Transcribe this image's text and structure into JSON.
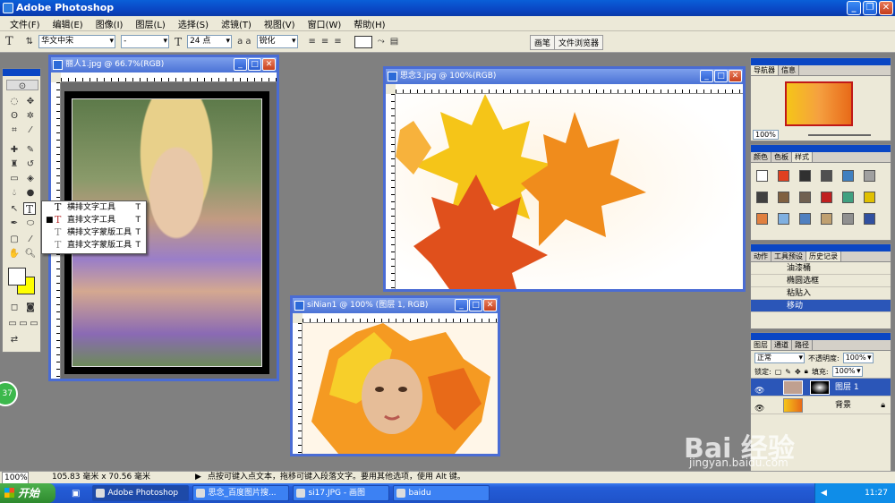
{
  "app": {
    "title": "Adobe Photoshop"
  },
  "menu": [
    "文件(F)",
    "编辑(E)",
    "图像(I)",
    "图层(L)",
    "选择(S)",
    "滤镜(T)",
    "视图(V)",
    "窗口(W)",
    "帮助(H)"
  ],
  "options": {
    "tool_glyph": "T",
    "font_family": "华文中宋",
    "font_style": "-",
    "font_size": "24 点",
    "aa_label": "a a",
    "antialias": "锐化",
    "tab_brushes": "画笔",
    "tab_browser": "文件浏览器"
  },
  "docs": {
    "doc1_title": "丽人1.jpg @ 66.7%(RGB)",
    "doc2_title": "思念3.jpg @ 100%(RGB)",
    "doc3_title": "siNian1 @ 100% (图层 1, RGB)"
  },
  "flyout": {
    "items": [
      {
        "label": "横排文字工具",
        "key": "T"
      },
      {
        "label": "直排文字工具",
        "key": "T"
      },
      {
        "label": "横排文字蒙版工具",
        "key": "T"
      },
      {
        "label": "直排文字蒙版工具",
        "key": "T"
      }
    ]
  },
  "navigator": {
    "tab1": "导航器",
    "tab2": "信息",
    "zoom": "100%"
  },
  "swatches": {
    "tab1": "颜色",
    "tab2": "色板",
    "tab3": "样式"
  },
  "history": {
    "tab1": "动作",
    "tab2": "工具预设",
    "tab3": "历史记录",
    "items": [
      "油漆桶",
      "椭圆选框",
      "粘贴入",
      "移动"
    ]
  },
  "layers": {
    "tab1": "图层",
    "tab2": "通道",
    "tab3": "路径",
    "blend": "正常",
    "opacity_label": "不透明度:",
    "opacity": "100%",
    "lock_label": "锁定:",
    "fill_label": "填充:",
    "fill": "100%",
    "rows": [
      "图层 1",
      "背景"
    ]
  },
  "status": {
    "zoom": "100%",
    "doc_size": "105.83 毫米 x 70.56 毫米",
    "hint": "点按可键入点文本，拖移可键入段落文字。要用其他选项，使用 Alt 键。"
  },
  "taskbar": {
    "start": "开始",
    "tasks": [
      "Adobe Photoshop",
      "思念_百度图片搜...",
      "si17.JPG - 画图",
      "baidu"
    ],
    "time": "11:27"
  },
  "watermark": {
    "brand": "Bai 经验",
    "url": "jingyan.baidu.com"
  },
  "badge": "37",
  "colors": {
    "title_blue": "#0a46c4",
    "selection": "#2b56b8",
    "foreground": "#ffffff",
    "background": "#ffff00"
  }
}
